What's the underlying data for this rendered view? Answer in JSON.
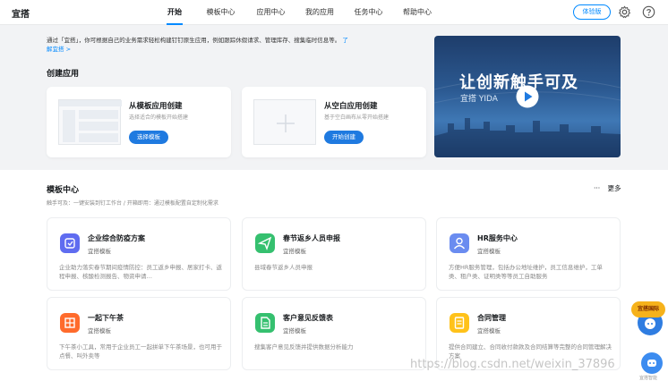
{
  "app": {
    "logo": "宜搭"
  },
  "nav": [
    {
      "label": "开始"
    },
    {
      "label": "模板中心"
    },
    {
      "label": "应用中心"
    },
    {
      "label": "我的应用"
    },
    {
      "label": "任务中心"
    },
    {
      "label": "帮助中心"
    }
  ],
  "header": {
    "trial_label": "体验版"
  },
  "intro": {
    "text": "通过「宜搭」，你可根据自己的业务需求轻松构建钉钉原生应用，例如跟踪休假请求、管理库存、搜集临时信息等。",
    "link": "了解宜搭 >"
  },
  "create": {
    "title": "创建应用",
    "from_template": {
      "title": "从模板应用创建",
      "subtitle": "选择适合的模板开始搭建",
      "button": "选择模板"
    },
    "from_blank": {
      "title": "从空白应用创建",
      "subtitle": "基于空白画布从零开始搭建",
      "button": "开始创建"
    }
  },
  "banner": {
    "title": "让创新触手可及",
    "subtitle": "宜搭 YIDA"
  },
  "templates": {
    "title": "模板中心",
    "more": "更多",
    "desc": "触手可及：一键安装到钉工作台 / 开箱即用：通过模板配置自定制化需求",
    "items": [
      {
        "name": "企业综合防疫方案",
        "tag": "宜搭模板",
        "text": "企业助力落实春节期间疫情防控：员工返乡申报、居家打卡、返程申报、核酸检测报告、物资申请…",
        "color": "#5f6cf0"
      },
      {
        "name": "春节返乡人员申报",
        "tag": "宜搭模板",
        "text": "县域春节返乡人员申报",
        "color": "#35c06f"
      },
      {
        "name": "HR服务中心",
        "tag": "宜搭模板",
        "text": "方便HR服务管理，包括办公地址维护，员工信息维护，工单类、租户类、证明类等等员工自助服务",
        "color": "#6a8cf0"
      },
      {
        "name": "一起下午茶",
        "tag": "宜搭模板",
        "text": "下午茶小工具，常用于企业员工一起拼单下午茶场景，也可用于点餐、叫外卖等",
        "color": "#ff6b2c"
      },
      {
        "name": "客户意见反馈表",
        "tag": "宜搭模板",
        "text": "搜集客户意见反馈并提供数据分析能力",
        "color": "#35c06f"
      },
      {
        "name": "合同管理",
        "tag": "宜搭模板",
        "text": "提供合同建立、合同收付款款及合同结算等完整的合同管理解决方案",
        "color": "#ffc21a"
      }
    ]
  },
  "watermark": "https://blog.csdn.net/weixin_37896",
  "float": {
    "badge": "宜搭国际",
    "bot_label": "宜搭智能"
  }
}
